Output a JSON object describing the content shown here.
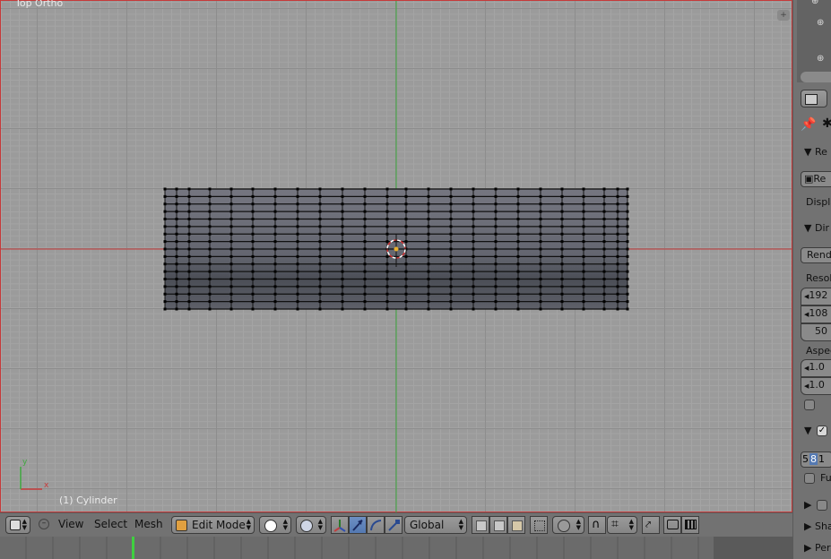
{
  "viewport": {
    "view_label": "Top Ortho",
    "object_label": "(1) Cylinder",
    "axis_x": "x",
    "axis_y": "y"
  },
  "header": {
    "view_menu": "View",
    "select_menu": "Select",
    "mesh_menu": "Mesh",
    "mode": "Edit Mode",
    "orientation": "Global"
  },
  "properties": {
    "render_panel": "Re",
    "render_button": "Re",
    "display_label": "Displa",
    "dimensions_panel": "Dir",
    "render_presets": "Rende",
    "resolution_label": "Resol",
    "res_x": "192",
    "res_y": "108",
    "res_pct": "50",
    "aspect_label": "Aspec",
    "aspect_x": "1.0",
    "aspect_y": "1.0",
    "frame_rate": [
      "5",
      "8",
      "1"
    ],
    "full_label": "Fu",
    "shading_panel": "Sha",
    "performance_panel": "Per"
  },
  "colors": {
    "viewport_bg": "#9b9b9b",
    "x_axis": "#c63a3a",
    "y_axis": "#3fa83f",
    "mesh_top": "#6f7079",
    "mesh_bottom": "#4d5058",
    "active_blue": "#5479b2"
  }
}
